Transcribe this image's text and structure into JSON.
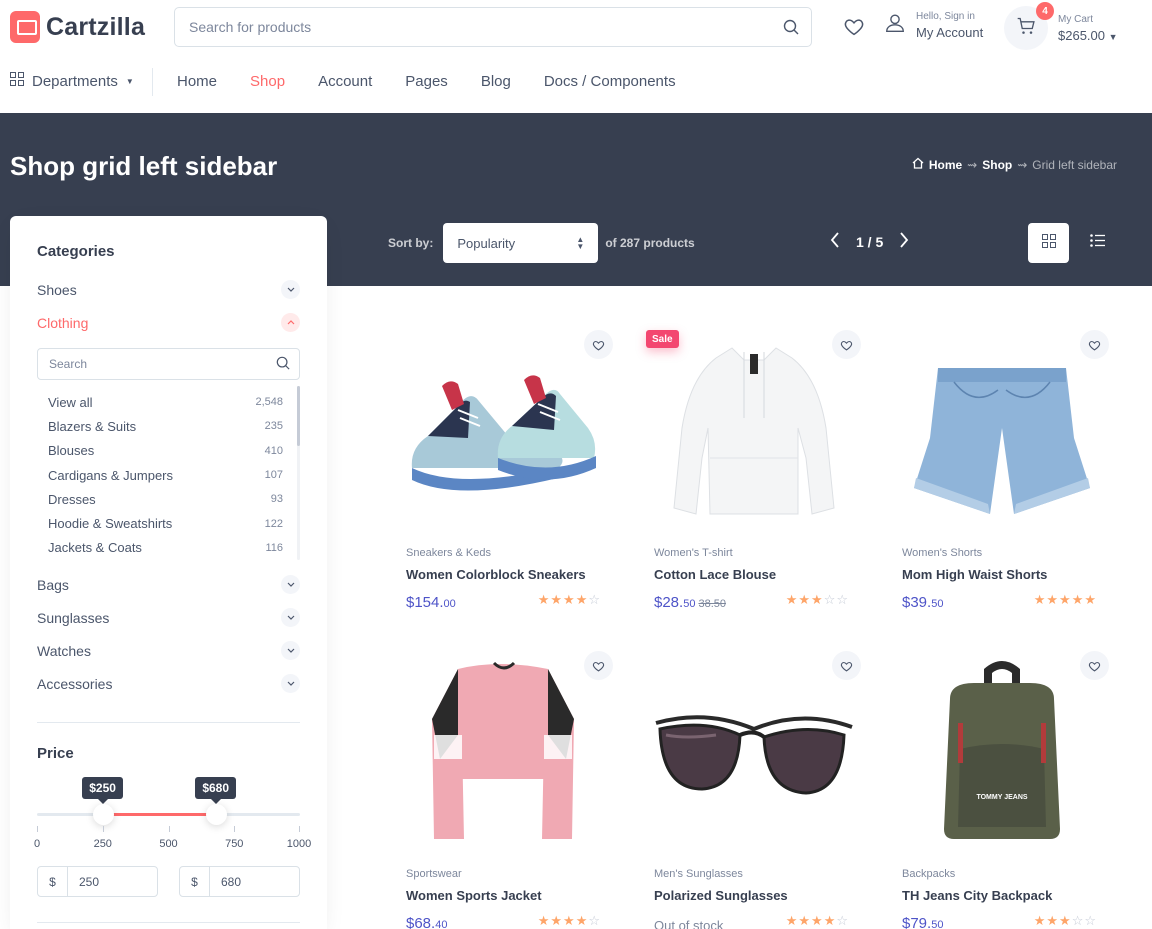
{
  "header": {
    "brand": "Cartzilla",
    "search_placeholder": "Search for products",
    "account_small": "Hello, Sign in",
    "account_big": "My Account",
    "cart_count": "4",
    "cart_small": "My Cart",
    "cart_total": "$265.00"
  },
  "nav": {
    "departments": "Departments",
    "links": [
      "Home",
      "Shop",
      "Account",
      "Pages",
      "Blog",
      "Docs / Components"
    ],
    "active": "Shop"
  },
  "hero": {
    "title": "Shop grid left sidebar",
    "breadcrumb": [
      "Home",
      "Shop",
      "Grid left sidebar"
    ],
    "sort_label": "Sort by:",
    "sort_value": "Popularity",
    "count_text": "of 287 products",
    "page": "1 / 5"
  },
  "sidebar": {
    "categories_title": "Categories",
    "categories": [
      {
        "label": "Shoes",
        "open": false
      },
      {
        "label": "Clothing",
        "open": true
      },
      {
        "label": "Bags",
        "open": false
      },
      {
        "label": "Sunglasses",
        "open": false
      },
      {
        "label": "Watches",
        "open": false
      },
      {
        "label": "Accessories",
        "open": false
      }
    ],
    "sub_search_placeholder": "Search",
    "subcategories": [
      {
        "label": "View all",
        "count": "2,548"
      },
      {
        "label": "Blazers & Suits",
        "count": "235"
      },
      {
        "label": "Blouses",
        "count": "410"
      },
      {
        "label": "Cardigans & Jumpers",
        "count": "107"
      },
      {
        "label": "Dresses",
        "count": "93"
      },
      {
        "label": "Hoodie & Sweatshirts",
        "count": "122"
      },
      {
        "label": "Jackets & Coats",
        "count": "116"
      }
    ],
    "price_title": "Price",
    "price_min": "$250",
    "price_max": "$680",
    "price_range_low": 250,
    "price_range_high": 680,
    "price_scale_max": 1000,
    "ticks": [
      "0",
      "250",
      "500",
      "750",
      "1000"
    ],
    "currency": "$",
    "input_min": "250",
    "input_max": "680"
  },
  "products": [
    {
      "category": "Sneakers & Keds",
      "name": "Women Colorblock Sneakers",
      "price_main": "$154.",
      "price_cents": "00",
      "old_price": "",
      "stock": "",
      "rating": 4,
      "sale": "",
      "image": "sneaker"
    },
    {
      "category": "Women's T-shirt",
      "name": "Cotton Lace Blouse",
      "price_main": "$28.",
      "price_cents": "50",
      "old_price": "38.50",
      "stock": "",
      "rating": 3,
      "sale": "Sale",
      "image": "blouse"
    },
    {
      "category": "Women's Shorts",
      "name": "Mom High Waist Shorts",
      "price_main": "$39.",
      "price_cents": "50",
      "old_price": "",
      "stock": "",
      "rating": 5,
      "sale": "",
      "image": "shorts"
    },
    {
      "category": "Sportswear",
      "name": "Women Sports Jacket",
      "price_main": "$68.",
      "price_cents": "40",
      "old_price": "",
      "stock": "",
      "rating": 4,
      "sale": "",
      "image": "sweater"
    },
    {
      "category": "Men's Sunglasses",
      "name": "Polarized Sunglasses",
      "price_main": "",
      "price_cents": "",
      "old_price": "",
      "stock": "Out of stock",
      "rating": 4,
      "sale": "",
      "image": "sunglasses"
    },
    {
      "category": "Backpacks",
      "name": "TH Jeans City Backpack",
      "price_main": "$79.",
      "price_cents": "50",
      "old_price": "",
      "stock": "",
      "rating": 3,
      "sale": "",
      "image": "backpack",
      "brand_text": "TOMMY JEANS"
    }
  ],
  "colors": {
    "accent": "#fe696a",
    "dark": "#373f50",
    "price": "#4e54c8",
    "star": "#fea569"
  }
}
